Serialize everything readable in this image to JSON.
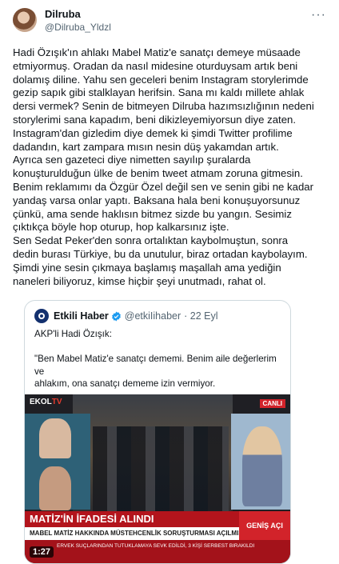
{
  "author": {
    "display_name": "Dilruba",
    "handle": "@Dilruba_Yldzl"
  },
  "more_label": "···",
  "tweet_text": "Hadi Özışık'ın ahlakı Mabel Matiz'e sanatçı demeye müsaade\netmiyormuş. Oradan da nasıl midesine oturduysam artık beni\ndolamış diline. Yahu sen geceleri benim Instagram storylerimde\ngezip sapık gibi stalklayan herifsin. Sana mı kaldı millete ahlak\ndersi vermek? Senin de bitmeyen Dilruba hazımsızlığının nedeni\nstorylerimi sana kapadım, beni dikizleyemiyorsun diye zaten.\nInstagram'dan gizledim diye demek ki şimdi Twitter profilime\ndadandın, kart zampara mısın nesin düş yakamdan artık.\nAyrıca sen gazeteci diye nimetten sayılıp şuralarda\nkonuşturulduğun ülke de benim tweet atmam zoruna gitmesin.\nBenim reklamımı da Özgür Özel değil sen ve senin gibi ne kadar\nyandaş varsa onlar yaptı. Baksana hala beni konuşuyorsunuz\nçünkü, ama sende haklısın bitmez sizde bu yangın. Sesimiz\nçıktıkça böyle hop oturup, hop kalkarsınız işte.\nSen Sedat Peker'den sonra ortalıktan kaybolmuştun, sonra\ndedin burası Türkiye, bu da unutulur, biraz ortadan kaybolayım.\nŞimdi yine sesin çıkmaya başlamış maşallah ama yediğin\nnaneleri biliyoruz, kimse hiçbir şeyi unutmadı, rahat ol.",
  "quote": {
    "name": "Etkili Haber",
    "handle": "@etkiIihaber",
    "date": "· 22 Eyl",
    "text": "AKP'li Hadi Özışık:\n\n\"Ben Mabel Matiz'e sanatçı dememi. Benim aile değerlerim ve\nahlakım, ona sanatçı dememe izin vermiyor.\n...",
    "video": {
      "channel_logo": "EKOL",
      "channel_logo_suffix": "TV",
      "live_label": "CANLI",
      "headline": "MATİZ'İN İFADESİ ALINDI",
      "subheadline": "MABEL MATİZ HAKKINDA MÜSTEHCENLİK SORUŞTURMASI AÇILMIŞTI",
      "badge": "GENİŞ AÇI",
      "ticker": "ERVEK SUÇLARINDAN TUTUKLAMAYA SEVK EDİLDİ, 3 KİŞİ SERBEST BIRAKILDI",
      "duration": "1:27"
    }
  }
}
